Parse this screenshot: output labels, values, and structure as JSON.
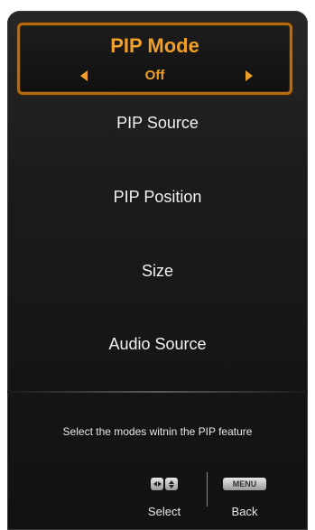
{
  "menu": {
    "selected": {
      "title": "PIP Mode",
      "value": "Off"
    },
    "items": [
      {
        "label": "PIP Source"
      },
      {
        "label": "PIP Position"
      },
      {
        "label": "Size"
      },
      {
        "label": "Audio Source"
      }
    ]
  },
  "help_text": "Select the modes witnin the PIP feature",
  "footer": {
    "select_label": "Select",
    "menu_key": "MENU",
    "back_label": "Back"
  },
  "colors": {
    "accent": "#f0a028",
    "background": "#1b1b1b",
    "text": "#f2f2f2"
  }
}
